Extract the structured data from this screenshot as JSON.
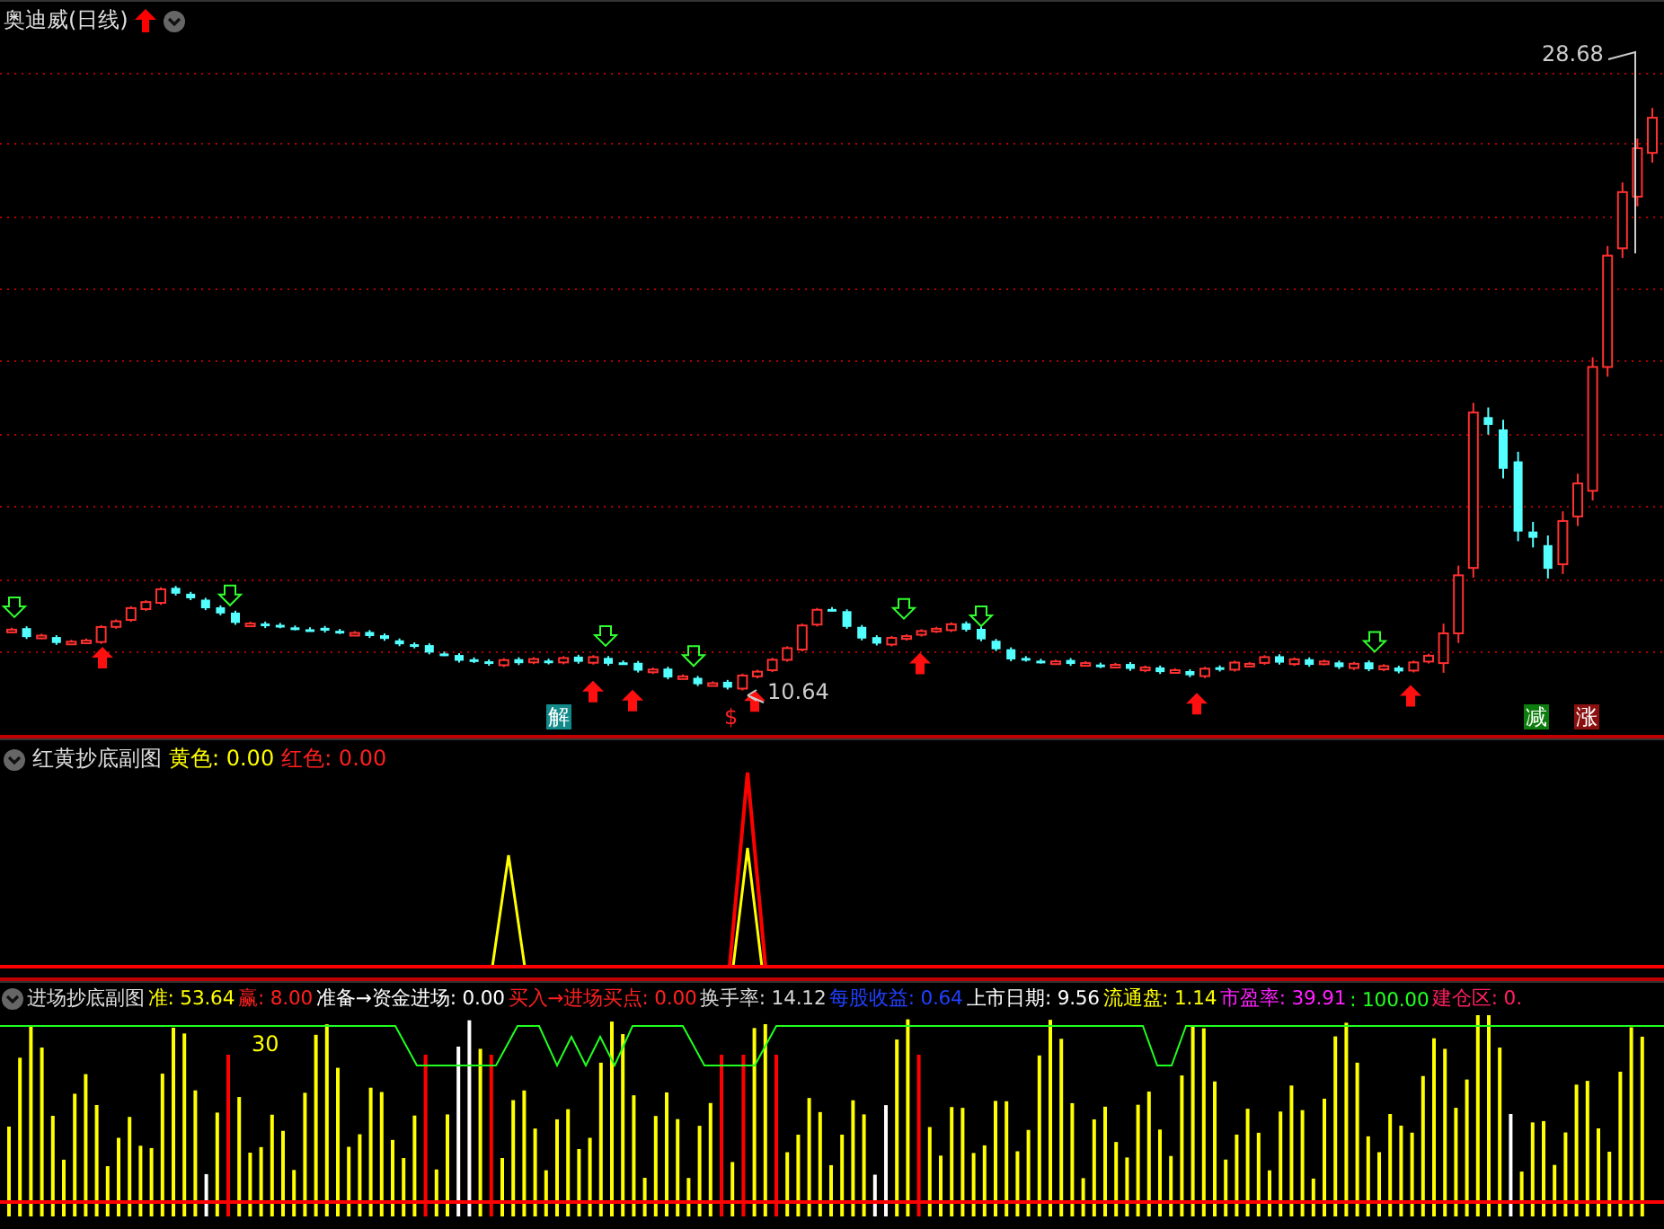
{
  "main_panel": {
    "title": "奥迪威(日线)",
    "high_label": "28.68",
    "low_label": "10.64",
    "markers": [
      {
        "text": "解",
        "color": "#138a8a",
        "kind": "box"
      },
      {
        "text": "$",
        "color": "#ff2020",
        "kind": "text"
      },
      {
        "text": "减",
        "color": "#0c7d0c",
        "kind": "box"
      },
      {
        "text": "涨",
        "color": "#8a1010",
        "kind": "box"
      }
    ]
  },
  "sub_panel_1": {
    "title": "红黄抄底副图",
    "readings": [
      {
        "text": "黄色: 0.00",
        "color": "#ffff00"
      },
      {
        "text": "红色: 0.00",
        "color": "#ff2020"
      }
    ]
  },
  "sub_panel_2": {
    "title": "进场抄底副图",
    "level_label": "30",
    "readings": [
      {
        "text": "准: 53.64",
        "color": "#ffff00"
      },
      {
        "text": "赢: 8.00",
        "color": "#ff2020"
      },
      {
        "text": "准备→资金进场: 0.00",
        "color": "#ffffff"
      },
      {
        "text": "买入→进场买点: 0.00",
        "color": "#ff2020"
      },
      {
        "text": "换手率: 14.12",
        "color": "#d8d8d8"
      },
      {
        "text": "每股收益: 0.64",
        "color": "#2040ff"
      },
      {
        "text": "上市日期: 9.56",
        "color": "#ffffff"
      },
      {
        "text": "流通盘: 1.14",
        "color": "#ffff00"
      },
      {
        "text": "市盈率: 39.91",
        "color": "#ff20ff"
      },
      {
        "text": ": 100.00",
        "color": "#20ff20"
      },
      {
        "text": "建仓区: 0.",
        "color": "#ff2060"
      }
    ]
  }
}
